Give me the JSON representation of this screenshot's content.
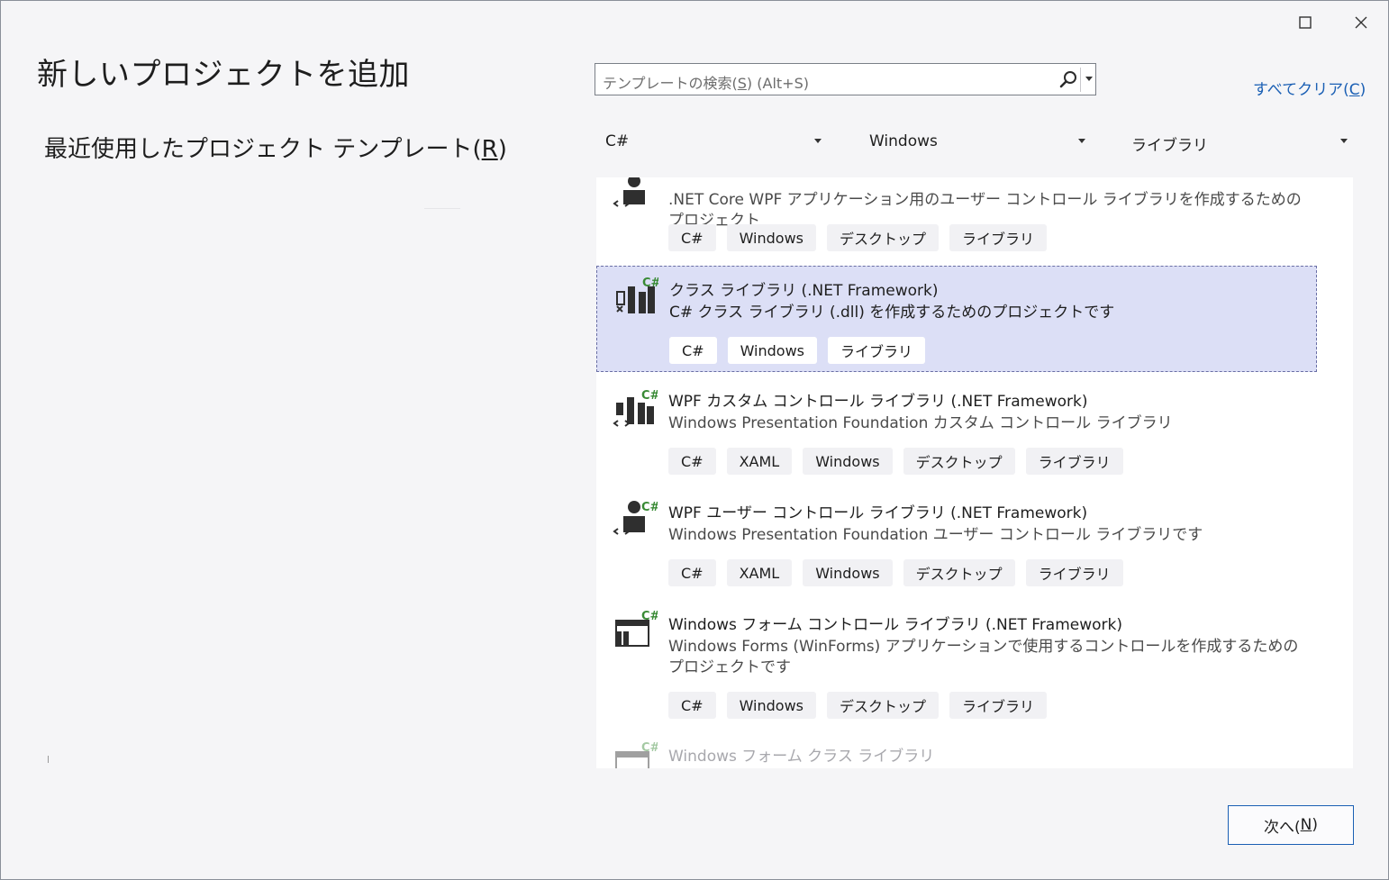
{
  "window": {
    "maximize_label": "Maximize",
    "close_label": "Close"
  },
  "title": "新しいプロジェクトを追加",
  "recent": {
    "label": "最近使用したプロジェクト テンプレート(",
    "key": "R",
    "suffix": ")"
  },
  "search": {
    "prefix": "テンプレートの検索(",
    "key": "S",
    "suffix": ") (Alt+S)"
  },
  "clear": {
    "label": "すべてクリア(",
    "key": "C",
    "suffix": ")"
  },
  "filters": {
    "language": "C#",
    "platform": "Windows",
    "project_type": "ライブラリ"
  },
  "templates": [
    {
      "name": "",
      "desc": ".NET Core WPF アプリケーション用のユーザー コントロール ライブラリを作成するためのプロジェクト",
      "tags": [
        "C#",
        "Windows",
        "デスクトップ",
        "ライブラリ"
      ],
      "icon": "wpf-user-control-icon"
    },
    {
      "name": "クラス ライブラリ (.NET Framework)",
      "desc": "C# クラス ライブラリ (.dll) を作成するためのプロジェクトです",
      "tags": [
        "C#",
        "Windows",
        "ライブラリ"
      ],
      "icon": "class-library-icon",
      "selected": true
    },
    {
      "name": "WPF カスタム コントロール ライブラリ (.NET Framework)",
      "desc": "Windows Presentation Foundation カスタム コントロール ライブラリ",
      "tags": [
        "C#",
        "XAML",
        "Windows",
        "デスクトップ",
        "ライブラリ"
      ],
      "icon": "wpf-custom-control-icon"
    },
    {
      "name": "WPF ユーザー コントロール ライブラリ (.NET Framework)",
      "desc": "Windows Presentation Foundation ユーザー コントロール ライブラリです",
      "tags": [
        "C#",
        "XAML",
        "Windows",
        "デスクトップ",
        "ライブラリ"
      ],
      "icon": "wpf-user-control-icon"
    },
    {
      "name": "Windows フォーム コントロール ライブラリ (.NET Framework)",
      "desc": "Windows Forms (WinForms) アプリケーションで使用するコントロールを作成するためのプロジェクトです",
      "tags": [
        "C#",
        "Windows",
        "デスクトップ",
        "ライブラリ"
      ],
      "icon": "winforms-control-icon"
    },
    {
      "name": "Windows フォーム クラス ライブラリ",
      "icon": "winforms-class-icon"
    }
  ],
  "next": {
    "label": "次へ(",
    "key": "N",
    "suffix": ")"
  },
  "colors": {
    "accent": "#1a5fb4",
    "selection": "#dcdff6",
    "csharp_green": "#388a34"
  }
}
